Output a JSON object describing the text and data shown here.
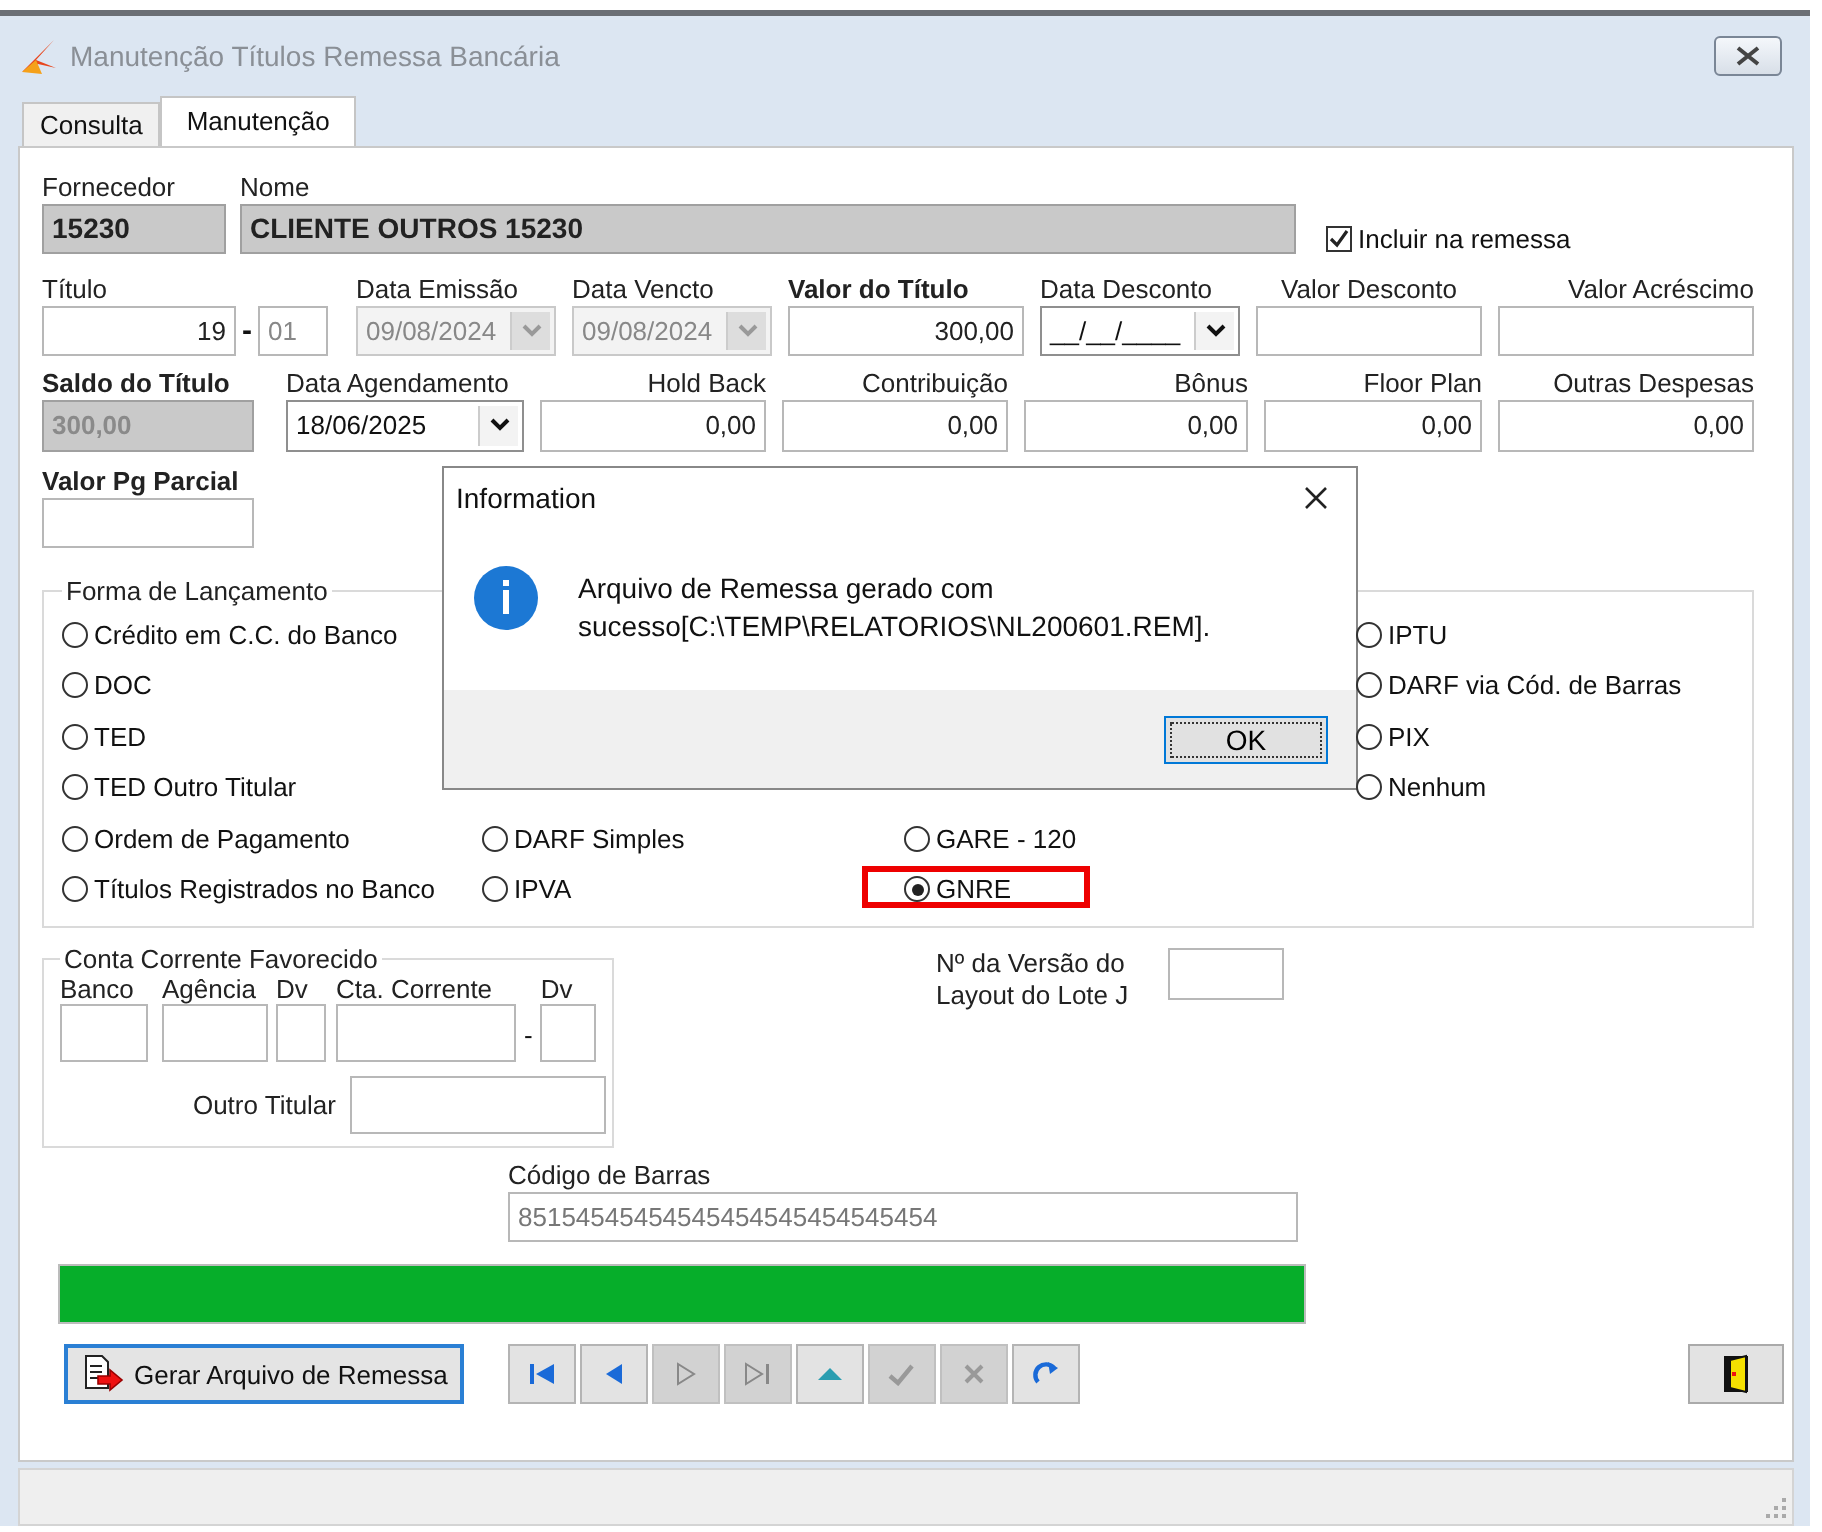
{
  "window": {
    "title": "Manutenção Títulos Remessa Bancária"
  },
  "tabs": [
    {
      "label": "Consulta",
      "selected": false
    },
    {
      "label": "Manutenção",
      "selected": true
    }
  ],
  "header": {
    "fornecedor": {
      "label": "Fornecedor",
      "value": "15230"
    },
    "nome": {
      "label": "Nome",
      "value": "CLIENTE OUTROS 15230"
    },
    "include": {
      "label": "Incluir na remessa",
      "checked": true
    }
  },
  "field_rows": [
    [
      {
        "kind": "split",
        "label": "Título",
        "value": "19",
        "separator": "-",
        "second_value": "01",
        "bold": false,
        "disabled": false
      },
      {
        "kind": "combo",
        "label": "Data Emissão",
        "value": "09/08/2024",
        "bold": false,
        "disabled": true
      },
      {
        "kind": "combo",
        "label": "Data Vencto",
        "value": "09/08/2024",
        "bold": false,
        "disabled": true
      },
      {
        "kind": "number",
        "label": "Valor do Título",
        "value": "300,00",
        "bold": true,
        "disabled": false
      },
      {
        "kind": "combo",
        "label": "Data Desconto",
        "value": "__/__/____",
        "bold": false,
        "disabled": false
      },
      {
        "kind": "number",
        "label": "Valor Desconto",
        "bold": false,
        "disabled": false
      },
      {
        "kind": "number",
        "label": "Valor Acréscimo",
        "bold": false,
        "disabled": false
      }
    ],
    [
      {
        "kind": "number",
        "label": "Saldo do Título",
        "value": "300,00",
        "bold": true,
        "disabled": true
      },
      {
        "kind": "combo",
        "label": "Data Agendamento",
        "value": "18/06/2025",
        "bold": false,
        "disabled": false
      },
      {
        "kind": "number",
        "label": "Hold Back",
        "value": "0,00",
        "bold": false,
        "disabled": false
      },
      {
        "kind": "number",
        "label": "Contribuição",
        "value": "0,00",
        "bold": false,
        "disabled": false
      },
      {
        "kind": "number",
        "label": "Bônus",
        "value": "0,00",
        "bold": false,
        "disabled": false
      },
      {
        "kind": "number",
        "label": "Floor Plan",
        "value": "0,00",
        "bold": false,
        "disabled": false
      },
      {
        "kind": "number",
        "label": "Outras Despesas",
        "value": "0,00",
        "bold": false,
        "disabled": false
      }
    ],
    [
      {
        "kind": "number",
        "label": "Valor Pg Parcial",
        "bold": true,
        "disabled": false
      }
    ]
  ],
  "payment_method": {
    "label": "Forma de Lançamento",
    "columns": [
      {
        "options": [
          {
            "label": "Crédito em C.C. do Banco",
            "selected": false,
            "highlighted": false
          },
          {
            "label": "DOC",
            "selected": false,
            "highlighted": false
          },
          {
            "label": "TED",
            "selected": false,
            "highlighted": false
          },
          {
            "label": "TED Outro Titular",
            "selected": false,
            "highlighted": false
          },
          {
            "label": "Ordem de Pagamento",
            "selected": false,
            "highlighted": false
          },
          {
            "label": "Títulos Registrados no Banco",
            "selected": false,
            "highlighted": false
          }
        ]
      },
      {
        "options": [
          {
            "label": "DARF Simples",
            "selected": false,
            "highlighted": false
          },
          {
            "label": "IPVA",
            "selected": false,
            "highlighted": false
          }
        ]
      },
      {
        "options": [
          {
            "label": "GARE - 120",
            "selected": false,
            "highlighted": false
          },
          {
            "label": "GNRE",
            "selected": true,
            "highlighted": true
          }
        ]
      },
      {
        "options": [
          {
            "label": "IPTU",
            "selected": false,
            "highlighted": false
          },
          {
            "label": "DARF via Cód. de Barras",
            "selected": false,
            "highlighted": false
          },
          {
            "label": "PIX",
            "selected": false,
            "highlighted": false
          },
          {
            "label": "Nenhum",
            "selected": false,
            "highlighted": false
          }
        ]
      }
    ]
  },
  "account": {
    "label": "Conta Corrente Favorecido",
    "fields": [
      {
        "label": "Banco"
      },
      {
        "label": "Agência"
      },
      {
        "label": "Dv"
      },
      {
        "label": "Cta. Corrente"
      },
      {
        "label": "Dv"
      }
    ],
    "separator": "-",
    "other_holder": {
      "label": "Outro Titular"
    }
  },
  "layout_version": {
    "label": "Nº da Versão do Layout do Lote J"
  },
  "barcode": {
    "label": "Código de Barras",
    "value": "85154545454545454545454545454"
  },
  "progress": {
    "level": 1
  },
  "generate_button": {
    "label": "Gerar Arquivo de Remessa"
  },
  "nav_buttons": [
    {
      "kind": "first",
      "disabled": false
    },
    {
      "kind": "previous",
      "disabled": false
    },
    {
      "kind": "next",
      "disabled": true
    },
    {
      "kind": "last",
      "disabled": true
    },
    {
      "kind": "up",
      "disabled": false
    },
    {
      "kind": "confirm",
      "disabled": true
    },
    {
      "kind": "cancel",
      "disabled": true
    },
    {
      "kind": "refresh",
      "disabled": false
    }
  ],
  "dialog": {
    "kind": "info",
    "title": "Information",
    "message": "Arquivo de Remessa gerado com sucesso[C:\\TEMP\\RELATORIOS\\NL200601.REM].",
    "button": "OK"
  }
}
